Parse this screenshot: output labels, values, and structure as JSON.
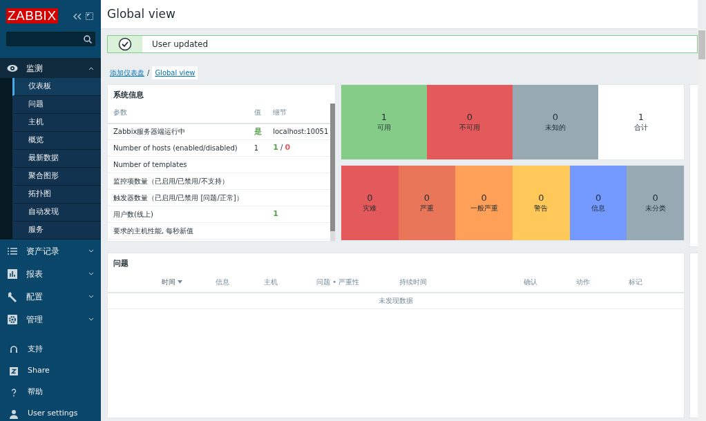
{
  "sidebar": {
    "logo": "ZABBIX",
    "menu": [
      {
        "label": "监测",
        "selected": true,
        "expanded": true,
        "children": [
          {
            "label": "仪表板",
            "selected": true
          },
          {
            "label": "问题",
            "selected": false
          },
          {
            "label": "主机",
            "selected": false
          },
          {
            "label": "概览",
            "selected": false
          },
          {
            "label": "最新数据",
            "selected": false
          },
          {
            "label": "聚合图形",
            "selected": false
          },
          {
            "label": "拓扑图",
            "selected": false
          },
          {
            "label": "自动发现",
            "selected": false
          },
          {
            "label": "服务",
            "selected": false
          }
        ]
      },
      {
        "label": "资产记录",
        "selected": false,
        "expanded": false
      },
      {
        "label": "报表",
        "selected": false,
        "expanded": false
      },
      {
        "label": "配置",
        "selected": false,
        "expanded": false
      },
      {
        "label": "管理",
        "selected": false,
        "expanded": false
      }
    ],
    "footer": [
      {
        "label": "支持"
      },
      {
        "label": "Share"
      },
      {
        "label": "帮助"
      },
      {
        "label": "User settings"
      }
    ]
  },
  "header": {
    "title": "Global view"
  },
  "message": {
    "kind": "success",
    "text": "User updated"
  },
  "breadcrumb_separator": "/",
  "breadcrumb": [
    {
      "label": "添加仪表盘",
      "selected": false
    },
    {
      "label": "Global view",
      "selected": true
    }
  ],
  "system_info": {
    "title": "系统信息",
    "columns": [
      "参数",
      "值",
      "细节"
    ],
    "rows": [
      {
        "parameter": "Zabbix服务器端运行中",
        "value": {
          "text": "是",
          "color": "#59a24f"
        },
        "details": [
          {
            "text": "localhost:10051"
          }
        ]
      },
      {
        "parameter": "Number of hosts (enabled/disabled)",
        "value": {
          "text": "1"
        },
        "details": [
          {
            "text": "1",
            "color": "#59a24f"
          },
          {
            "text": " / "
          },
          {
            "text": "0",
            "color": "#e45959"
          }
        ]
      },
      {
        "parameter": "Number of templates"
      },
      {
        "parameter": "监控项数量（已启用/已禁用/不支持）"
      },
      {
        "parameter": "触发器数量（已启用/已禁用 [问题/正常]）"
      },
      {
        "parameter": "用户数(线上)",
        "details": [
          {
            "text": "1",
            "color": "#59a24f"
          }
        ]
      },
      {
        "parameter": "要求的主机性能, 每秒新值"
      }
    ]
  },
  "host_availability": [
    {
      "count": "1",
      "label": "可用",
      "color": "#86cc89"
    },
    {
      "count": "0",
      "label": "不可用",
      "color": "#e45959"
    },
    {
      "count": "0",
      "label": "未知的",
      "color": "#97aab3"
    },
    {
      "count": "1",
      "label": "合计",
      "color": "#ffffff"
    }
  ],
  "problem_severity": [
    {
      "count": "0",
      "label": "灾难",
      "color": "#e45959"
    },
    {
      "count": "0",
      "label": "严重",
      "color": "#e97659"
    },
    {
      "count": "0",
      "label": "一般严重",
      "color": "#ffa059"
    },
    {
      "count": "0",
      "label": "警告",
      "color": "#ffc859"
    },
    {
      "count": "0",
      "label": "信息",
      "color": "#7499ff"
    },
    {
      "count": "0",
      "label": "未分类",
      "color": "#97aab3"
    }
  ],
  "problems": {
    "title": "问题",
    "columns": [
      {
        "label": "时间",
        "sorted": true
      },
      {
        "label": "信息",
        "sorted": false
      },
      {
        "label": "主机",
        "sorted": false
      },
      {
        "label": "问题 • 严重性",
        "sorted": false
      },
      {
        "label": "持续时间",
        "sorted": false
      },
      {
        "label": "确认",
        "sorted": false
      },
      {
        "label": "动作",
        "sorted": false
      },
      {
        "label": "标记",
        "sorted": false
      }
    ],
    "empty_text": "未发现数据"
  }
}
